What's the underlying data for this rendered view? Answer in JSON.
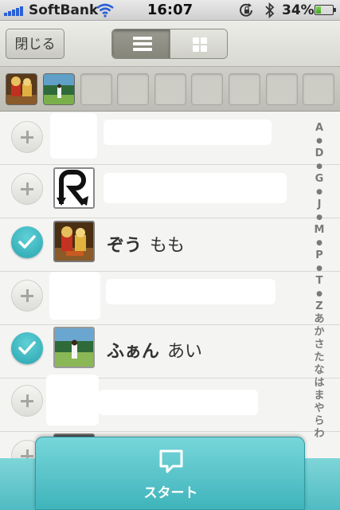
{
  "status_bar": {
    "carrier": "SoftBank",
    "time": "16:07",
    "battery_percent": "34%",
    "battery_level": 0.34,
    "icons": [
      "signal-icon",
      "wifi-icon",
      "rotation-lock-icon",
      "bluetooth-icon",
      "battery-icon"
    ]
  },
  "toolbar": {
    "close_label": "閉じる",
    "view_modes": [
      {
        "icon": "list-icon",
        "selected": true
      },
      {
        "icon": "grid-icon",
        "selected": false
      }
    ]
  },
  "selection_strip": {
    "filled_count": 2,
    "empty_count": 7
  },
  "contacts": [
    {
      "state": "add",
      "name_bold": "",
      "name_regular": "",
      "avatar": "blank"
    },
    {
      "state": "add",
      "name_bold": "",
      "name_regular": "",
      "avatar": "arrow-logo"
    },
    {
      "state": "selected",
      "name_bold": "ぞう",
      "name_regular": "もも",
      "avatar": "photo"
    },
    {
      "state": "add",
      "name_bold": "",
      "name_regular": "",
      "avatar": "blank"
    },
    {
      "state": "selected",
      "name_bold": "ふぁん",
      "name_regular": "あい",
      "avatar": "photo"
    },
    {
      "state": "add",
      "name_bold": "",
      "name_regular": "",
      "avatar": "blank"
    }
  ],
  "index": [
    "A",
    "●",
    "D",
    "●",
    "G",
    "●",
    "J",
    "●",
    "M",
    "●",
    "P",
    "●",
    "T",
    "●",
    "Z",
    "あ",
    "か",
    "さ",
    "た",
    "な",
    "は",
    "ま",
    "や",
    "ら",
    "わ"
  ],
  "start_button": {
    "label": "スタート",
    "icon": "chat-bubble-icon"
  },
  "colors": {
    "accent": "#3fb4bb",
    "accent_light": "#77d6da",
    "check": "#2aa5b0"
  }
}
